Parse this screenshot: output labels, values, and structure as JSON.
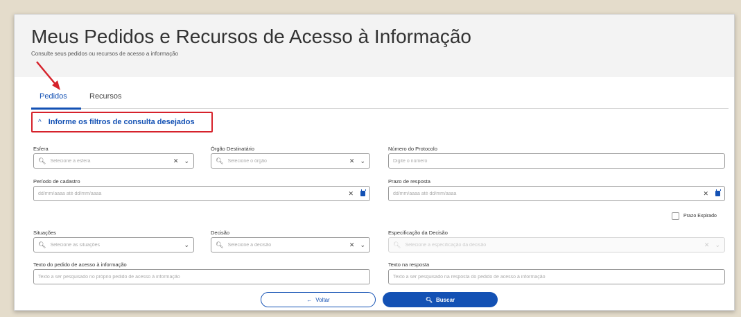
{
  "header": {
    "title": "Meus Pedidos e Recursos de Acesso à Informação",
    "subtitle": "Consulte seus pedidos ou recursos de acesso a informação"
  },
  "tabs": [
    {
      "label": "Pedidos",
      "active": true
    },
    {
      "label": "Recursos",
      "active": false
    }
  ],
  "filters_toggle": {
    "label": "Informe os filtros de consulta desejados",
    "icon": "chevron-up-icon"
  },
  "fields": {
    "esfera": {
      "label": "Esfera",
      "placeholder": "Selecione a esfera"
    },
    "orgao": {
      "label": "Órgão Destinatário",
      "placeholder": "Selecione o órgão"
    },
    "protocolo": {
      "label": "Número do Protocolo",
      "placeholder": "Digite o número"
    },
    "periodo": {
      "label": "Período de cadastro",
      "placeholder": "dd/mm/aaaa até dd/mm/aaaa"
    },
    "prazo": {
      "label": "Prazo de resposta",
      "placeholder": "dd/mm/aaaa até dd/mm/aaaa"
    },
    "prazo_expirado": {
      "label": "Prazo Expirado",
      "checked": false
    },
    "situacoes": {
      "label": "Situações",
      "placeholder": "Selecione as situações"
    },
    "decisao": {
      "label": "Decisão",
      "placeholder": "Selecione a decisão"
    },
    "especificacao": {
      "label": "Especificação da Decisão",
      "placeholder": "Selecione a especificação da decisão"
    },
    "texto_pedido": {
      "label": "Texto do pedido de acesso à informação",
      "placeholder": "Texto a ser pesquisado no próprio pedido de acesso à informação"
    },
    "texto_resposta": {
      "label": "Texto na resposta",
      "placeholder": "Texto a ser pesquisado na resposta do pedido de acesso à informação"
    }
  },
  "buttons": {
    "voltar": {
      "label": "Voltar",
      "icon": "arrow-left-icon"
    },
    "buscar": {
      "label": "Buscar",
      "icon": "search-icon"
    }
  },
  "colors": {
    "primary": "#1351b4",
    "highlight": "#d6222b",
    "background": "#e4dccb"
  }
}
